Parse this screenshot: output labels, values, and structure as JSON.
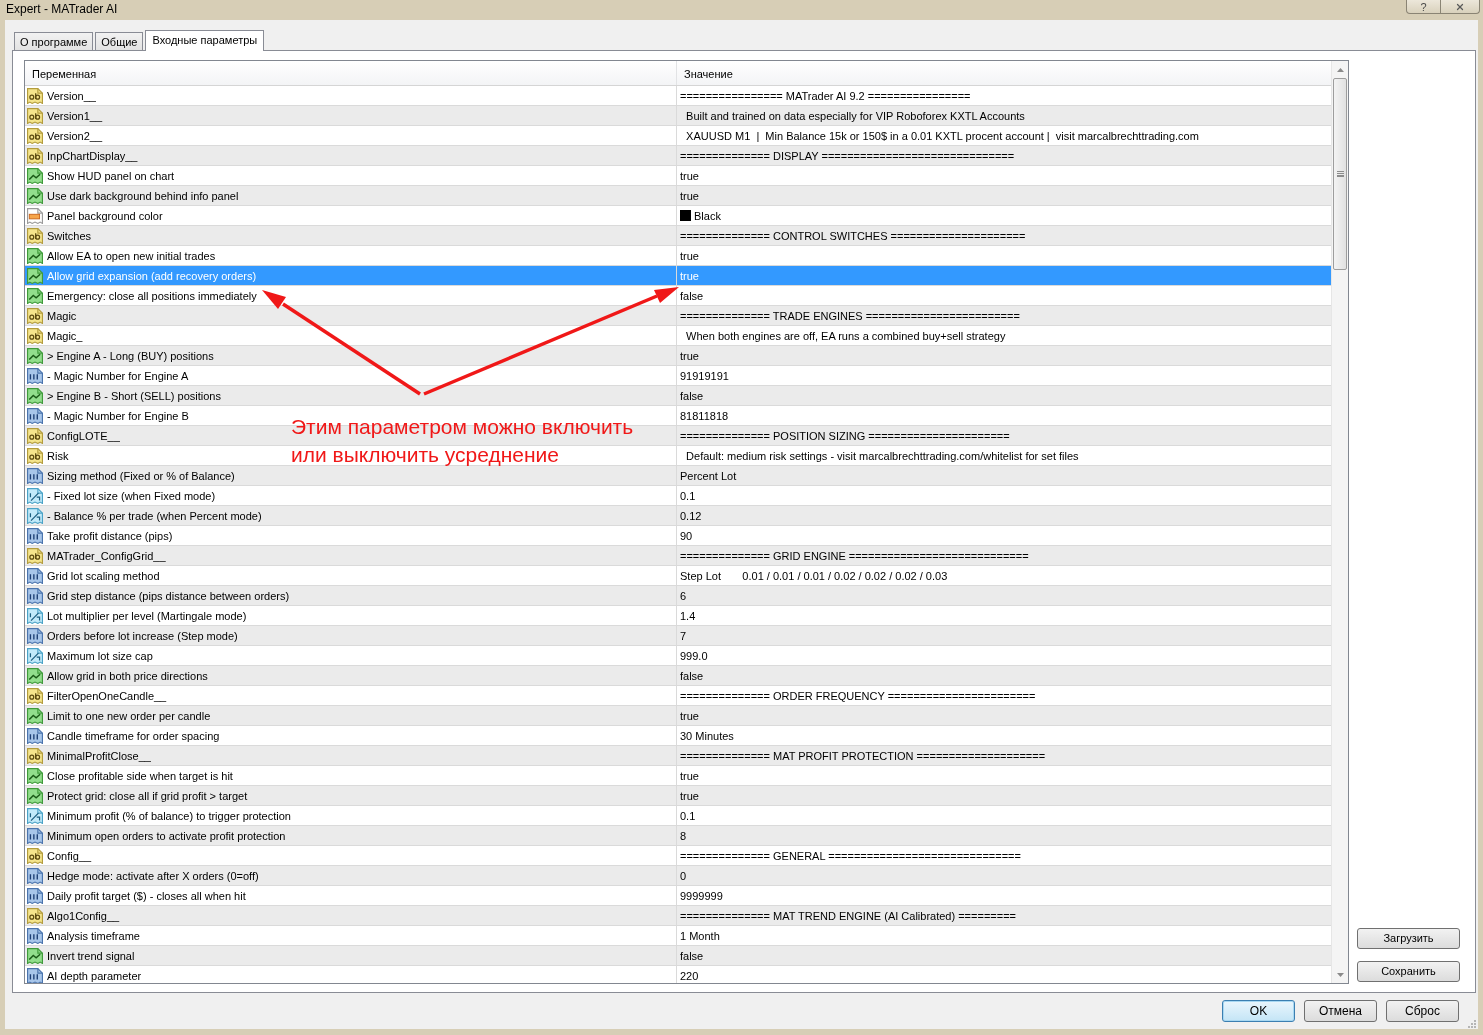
{
  "window": {
    "title": "Expert - MATrader AI",
    "help_button": "?"
  },
  "tabs": [
    {
      "label": "О программе",
      "selected": false
    },
    {
      "label": "Общие",
      "selected": false
    },
    {
      "label": "Входные параметры",
      "selected": true
    }
  ],
  "table": {
    "columns": [
      "Переменная",
      "Значение"
    ],
    "rows": [
      {
        "kind": "string",
        "name": "Version__",
        "value": "================ MATrader AI 9.2 ================",
        "selected": false
      },
      {
        "kind": "string",
        "name": "Version1__",
        "value": "  Built and trained on data especially for VIP Roboforex KXTL Accounts",
        "selected": false
      },
      {
        "kind": "string",
        "name": "Version2__",
        "value": "  XAUUSD M1  |  Min Balance 15k or 150$ in a 0.01 KXTL procent account |  visit marcalbrechttrading.com",
        "selected": false
      },
      {
        "kind": "string",
        "name": "InpChartDisplay__",
        "value": "============== DISPLAY ==============================",
        "selected": false
      },
      {
        "kind": "bool",
        "name": "Show HUD panel on chart",
        "value": "true",
        "selected": false
      },
      {
        "kind": "bool",
        "name": "Use dark background behind info panel",
        "value": "true",
        "selected": false
      },
      {
        "kind": "color",
        "name": "Panel background color",
        "value": "Black",
        "color": "#000000",
        "selected": false
      },
      {
        "kind": "string",
        "name": "Switches",
        "value": "============== CONTROL SWITCHES =====================",
        "selected": false
      },
      {
        "kind": "bool",
        "name": "Allow EA to open new initial trades",
        "value": "true",
        "selected": false
      },
      {
        "kind": "bool",
        "name": "Allow grid expansion (add recovery orders)",
        "value": "true",
        "selected": true
      },
      {
        "kind": "bool",
        "name": "Emergency: close all positions immediately",
        "value": "false",
        "selected": false
      },
      {
        "kind": "string",
        "name": "Magic",
        "value": "============== TRADE ENGINES ========================",
        "selected": false
      },
      {
        "kind": "string",
        "name": "Magic_",
        "value": "  When both engines are off, EA runs a combined buy+sell strategy",
        "selected": false
      },
      {
        "kind": "bool",
        "name": "> Engine A - Long (BUY) positions",
        "value": "true",
        "selected": false
      },
      {
        "kind": "int",
        "name": "- Magic Number for Engine A",
        "value": "91919191",
        "selected": false
      },
      {
        "kind": "bool",
        "name": "> Engine B - Short (SELL) positions",
        "value": "false",
        "selected": false
      },
      {
        "kind": "int",
        "name": "- Magic Number for Engine B",
        "value": "81811818",
        "selected": false
      },
      {
        "kind": "string",
        "name": "ConfigLOTE__",
        "value": "============== POSITION SIZING ======================",
        "selected": false
      },
      {
        "kind": "string",
        "name": "Risk",
        "value": "  Default: medium risk settings - visit marcalbrechttrading.com/whitelist for set files",
        "selected": false
      },
      {
        "kind": "int",
        "name": "Sizing method (Fixed or % of Balance)",
        "value": "Percent Lot",
        "selected": false
      },
      {
        "kind": "double",
        "name": "- Fixed lot size (when Fixed mode)",
        "value": "0.1",
        "selected": false
      },
      {
        "kind": "double",
        "name": "- Balance % per trade (when Percent mode)",
        "value": "0.12",
        "selected": false
      },
      {
        "kind": "int",
        "name": "Take profit distance (pips)",
        "value": "90",
        "selected": false
      },
      {
        "kind": "string",
        "name": "MATrader_ConfigGrid__",
        "value": "============== GRID ENGINE ============================",
        "selected": false
      },
      {
        "kind": "int",
        "name": "Grid lot scaling method",
        "value": "Step Lot       0.01 / 0.01 / 0.01 / 0.02 / 0.02 / 0.02 / 0.03",
        "selected": false
      },
      {
        "kind": "int",
        "name": "Grid step distance (pips distance between orders)",
        "value": "6",
        "selected": false
      },
      {
        "kind": "double",
        "name": "Lot multiplier per level (Martingale mode)",
        "value": "1.4",
        "selected": false
      },
      {
        "kind": "int",
        "name": "Orders before lot increase (Step mode)",
        "value": "7",
        "selected": false
      },
      {
        "kind": "double",
        "name": "Maximum lot size cap",
        "value": "999.0",
        "selected": false
      },
      {
        "kind": "bool",
        "name": "Allow grid in both price directions",
        "value": "false",
        "selected": false
      },
      {
        "kind": "string",
        "name": "FilterOpenOneCandle__",
        "value": "============== ORDER FREQUENCY =======================",
        "selected": false
      },
      {
        "kind": "bool",
        "name": "Limit to one new order per candle",
        "value": "true",
        "selected": false
      },
      {
        "kind": "int",
        "name": "Candle timeframe for order spacing",
        "value": "30 Minutes",
        "selected": false
      },
      {
        "kind": "string",
        "name": "MinimalProfitClose__",
        "value": "============== MAT PROFIT PROTECTION ====================",
        "selected": false
      },
      {
        "kind": "bool",
        "name": "Close profitable side when target is hit",
        "value": "true",
        "selected": false
      },
      {
        "kind": "bool",
        "name": "Protect grid: close all if grid profit > target",
        "value": "true",
        "selected": false
      },
      {
        "kind": "double",
        "name": "Minimum profit (% of balance) to trigger protection",
        "value": "0.1",
        "selected": false
      },
      {
        "kind": "int",
        "name": "Minimum open orders to activate profit protection",
        "value": "8",
        "selected": false
      },
      {
        "kind": "string",
        "name": "Config__",
        "value": "============== GENERAL ==============================",
        "selected": false
      },
      {
        "kind": "int",
        "name": "Hedge mode: activate after X orders (0=off)",
        "value": "0",
        "selected": false
      },
      {
        "kind": "int",
        "name": "Daily profit target ($) - closes all when hit",
        "value": "9999999",
        "selected": false
      },
      {
        "kind": "string",
        "name": "Algo1Config__",
        "value": "============== MAT TREND ENGINE (AI Calibrated) =========",
        "selected": false
      },
      {
        "kind": "int",
        "name": "Analysis timeframe",
        "value": "1 Month",
        "selected": false
      },
      {
        "kind": "bool",
        "name": "Invert trend signal",
        "value": "false",
        "selected": false
      },
      {
        "kind": "int",
        "name": "AI depth parameter",
        "value": "220",
        "selected": false
      }
    ]
  },
  "side_buttons": [
    "Загрузить",
    "Сохранить"
  ],
  "dialog_buttons": [
    {
      "label": "OK",
      "default": true
    },
    {
      "label": "Отмена",
      "default": false
    },
    {
      "label": "Сброс",
      "default": false
    }
  ],
  "annotation": {
    "lines": [
      "Этим параметром можно включить",
      "или выключить усреднение"
    ]
  }
}
